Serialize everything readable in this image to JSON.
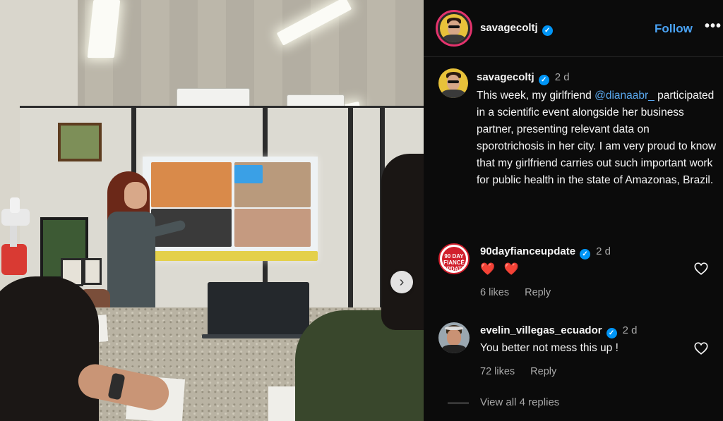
{
  "post": {
    "author": "savagecoltj",
    "follow_label": "Follow",
    "more_label": "•••",
    "next_glyph": "›"
  },
  "caption": {
    "author": "savagecoltj",
    "time": "2 d",
    "text_before": "This week, my girlfriend ",
    "mention": "@dianaabr_",
    "text_after": " participated in a scientific event alongside her business partner, presenting relevant data on sporotrichosis in her city. I am very proud to know that my girlfriend carries out such important work for public health in the state of Amazonas, Brazil."
  },
  "comments": [
    {
      "author": "90dayfianceupdate",
      "time": "2 d",
      "text": "❤️ ❤️",
      "likes": "6 likes",
      "reply_label": "Reply",
      "avatar_text": "90 DAY FIANCÉ UPDATE"
    },
    {
      "author": "evelin_villegas_ecuador",
      "time": "2 d",
      "text": "You better not mess this up !",
      "likes": "72 likes",
      "reply_label": "Reply",
      "view_replies": "View all 4 replies"
    }
  ],
  "colors": {
    "accent": "#0095f6",
    "follow": "#4aa3f5",
    "like_heart": "#ff3040",
    "background": "#0b0b0b"
  },
  "icons": [
    "verified-badge-icon",
    "heart-outline-icon",
    "more-options-icon",
    "chevron-right-icon"
  ]
}
